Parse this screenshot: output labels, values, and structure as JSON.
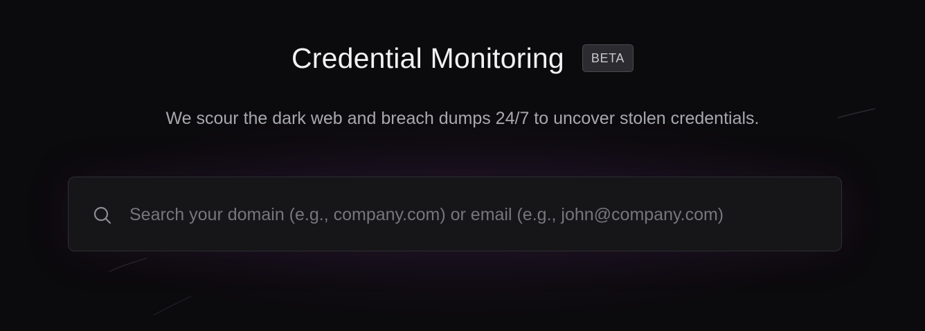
{
  "header": {
    "title": "Credential Monitoring",
    "badge": "BETA",
    "subtitle": "We scour the dark web and breach dumps 24/7 to uncover stolen credentials."
  },
  "search": {
    "icon": "search-icon",
    "value": "",
    "placeholder": "Search your domain (e.g., company.com) or email (e.g., john@company.com)"
  },
  "colors": {
    "background": "#0b0a0c",
    "title": "#f2f2f3",
    "subtitle": "#a9a8ad",
    "badge_bg": "#2c2b2f",
    "search_bg": "#161518",
    "glow": "#783c96"
  }
}
